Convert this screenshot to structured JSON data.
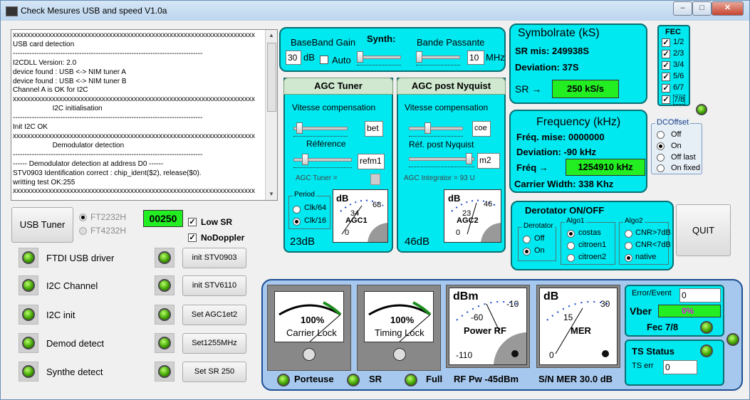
{
  "window": {
    "title": "Check Mesures USB and speed V1.0a",
    "min": "–",
    "max": "□",
    "close": "✕"
  },
  "log": [
    "xxxxxxxxxxxxxxxxxxxxxxxxxxxxxxxxxxxxxxxxxxxxxxxxxxxxxxxxxxxxxxxxxxxx",
    "USB card detection",
    "--------------------------------------------------------------------------------",
    "I2CDLL Version: 2.0",
    "device found : USB <-> NIM tuner A",
    "device found : USB <-> NIM tuner B",
    "Channel A is OK for I2C",
    "xxxxxxxxxxxxxxxxxxxxxxxxxxxxxxxxxxxxxxxxxxxxxxxxxxxxxxxxxxxxxxxxxxxx",
    "                    I2C initialisation",
    "--------------------------------------------------------------------------------",
    "Init I2C OK",
    "xxxxxxxxxxxxxxxxxxxxxxxxxxxxxxxxxxxxxxxxxxxxxxxxxxxxxxxxxxxxxxxxxxxx",
    "                    Demodulator detection",
    "--------------------------------------------------------------------------------",
    "------ Demodulator detection at address D0 ------",
    "STV0903 Identification correct : chip_ident($2), release($0).",
    "writting test OK:255",
    "xxxxxxxxxxxxxxxxxxxxxxxxxxxxxxxxxxxxxxxxxxxxxxxxxxxxxxxxxxxxxxxxxxxx"
  ],
  "left": {
    "usb_tuner": "USB Tuner",
    "ft2232": "FT2232H",
    "ft4232": "FT4232H",
    "counter": "00250",
    "low_sr": "Low SR",
    "nodoppler": "NoDoppler",
    "status": [
      "FTDI USB driver",
      "I2C Channel",
      "I2C init",
      "Demod detect",
      "Synthe detect"
    ],
    "init_buttons": [
      "init STV0903",
      "init STV6110",
      "Set AGC1et2",
      "Set1255MHz",
      "Set SR 250"
    ]
  },
  "synth": {
    "baseband_label": "BaseBand Gain",
    "synth_label": "Synth:",
    "bande_label": "Bande Passante",
    "gain_value": "30",
    "gain_unit": "dB",
    "auto": "Auto",
    "bw_value": "10",
    "bw_unit": "MHz"
  },
  "agc_tuner": {
    "title": "AGC Tuner",
    "vitesse": "Vitesse compensation",
    "vitesse_value": "bet",
    "reference": "Référence",
    "ref_value": "refm1",
    "agc_label": "AGC Tuner =",
    "period": "Period",
    "clk64": "Clk/64",
    "clk16": "Clk/16",
    "db": "23dB",
    "meter": {
      "unit": "dB",
      "name": "AGC1",
      "t0": "0",
      "t34": "34",
      "t68": "68"
    }
  },
  "agc_nyq": {
    "title": "AGC post Nyquist",
    "vitesse": "Vitesse compensation",
    "vitesse_value": "coe",
    "reference": "Réf. post Nyquist",
    "ref_value": "m2",
    "agc_label": "AGC Integrator = 93 U",
    "db": "46dB",
    "meter": {
      "unit": "dB",
      "name": "AGC2",
      "t0": "0",
      "t23": "23",
      "t46": "46"
    }
  },
  "symbolrate": {
    "title": "Symbolrate (kS)",
    "mis": "SR mis:  249938S",
    "deviation": "Deviation: 37S",
    "sr": "SR →",
    "sr_value": "250 kS/s"
  },
  "fec": {
    "title": "FEC",
    "rates": [
      "1/2",
      "2/3",
      "3/4",
      "5/6",
      "6/7",
      "7/8"
    ]
  },
  "dcoffset": {
    "title": "DCOffset",
    "options": [
      "Off",
      "On",
      "Off last",
      "On fixed"
    ],
    "selected": 1
  },
  "frequency": {
    "title": "Frequency (kHz)",
    "mise": "Fréq. mise:  0000000",
    "deviation": "Deviation:   -90 kHz",
    "freq": "Fréq →",
    "freq_value": "1254910 kHz",
    "carrier": "Carrier Width:  338 Khz"
  },
  "derotator": {
    "title": "Derotator  ON/OFF",
    "grp": "Derotator",
    "off": "Off",
    "on": "On",
    "algo1": "Algo1",
    "algo1_opts": [
      "costas",
      "citroen1",
      "citroen2"
    ],
    "algo2": "Algo2",
    "algo2_opts": [
      "CNR>7dB",
      "CNR<7dB",
      "native"
    ]
  },
  "quit": "QUIT",
  "bottom": {
    "carrier_pct": "100%",
    "carrier_lbl": "Carrier Lock",
    "timing_pct": "100%",
    "timing_lbl": "Timing Lock",
    "power": {
      "unit": "dBm",
      "name": "Power RF",
      "t1": "-10",
      "t2": "-60",
      "t3": "-110"
    },
    "mer": {
      "unit": "dB",
      "name": "MER",
      "t1": "30",
      "t2": "15",
      "t3": "0"
    },
    "porteuse": "Porteuse",
    "sr": "SR",
    "full": "Full",
    "rfpw": "RF Pw -45dBm",
    "snmer": "S/N MER 30.0 dB",
    "error_event": "Error/Event",
    "error_value": "0",
    "vber": "Vber",
    "vber_value": "0%",
    "fec": "Fec 7/8",
    "ts_status": "TS Status",
    "ts_err": "TS err",
    "ts_err_value": "0"
  },
  "colors": {
    "panel": "#00e8f0",
    "green": "#22ee22",
    "bigpanel": "#a7c8ee"
  }
}
